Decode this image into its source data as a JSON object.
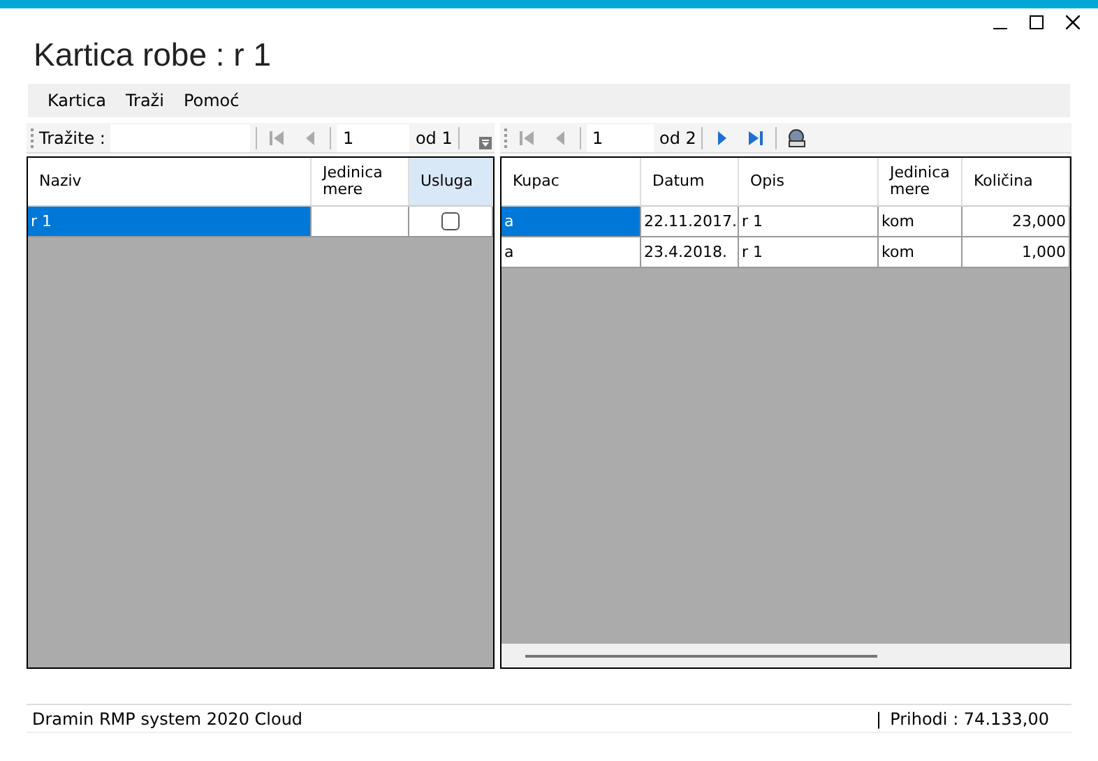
{
  "window": {
    "title": "Kartica robe : r 1"
  },
  "menu": [
    "Kartica",
    "Traži",
    "Pomoć"
  ],
  "left_toolbar": {
    "search_label": "Tražite :",
    "page": "1",
    "of": "od 1",
    "nav": [
      {
        "kind": "first",
        "disabled": true
      },
      {
        "kind": "prev",
        "disabled": true
      }
    ]
  },
  "right_toolbar": {
    "page": "1",
    "of": "od 2",
    "nav_back": [
      {
        "kind": "first",
        "disabled": true
      },
      {
        "kind": "prev",
        "disabled": true
      }
    ],
    "nav_fwd": [
      {
        "kind": "next",
        "disabled": false
      },
      {
        "kind": "last",
        "disabled": false
      }
    ]
  },
  "left_table": {
    "columns": [
      {
        "label": "Naziv",
        "selected": false
      },
      {
        "label": "Jedinica mere",
        "selected": false
      },
      {
        "label": "Usluga",
        "selected": true
      }
    ],
    "rows": [
      {
        "naziv": "r 1",
        "jedinica": "",
        "usluga": false,
        "selected": true
      }
    ]
  },
  "right_table": {
    "columns": [
      "Kupac",
      "Datum",
      "Opis",
      "Jedinica mere",
      "Količina"
    ],
    "rows": [
      {
        "cells": [
          "a",
          "22.11.2017.",
          "r 1",
          "kom",
          "23,000"
        ],
        "selected": true
      },
      {
        "cells": [
          "a",
          "23.4.2018.",
          "r 1",
          "kom",
          "1,000"
        ],
        "selected": false
      }
    ]
  },
  "status_bar": {
    "left": "Dramin RMP system 2020 Cloud",
    "separator": "|",
    "right": "Prihodi : 74.133,00"
  }
}
